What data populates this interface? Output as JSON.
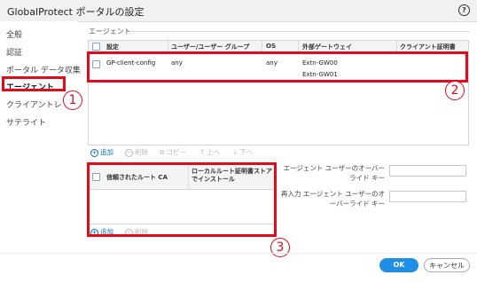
{
  "title": "GlobalProtect ポータルの設定",
  "sidebar": {
    "items": [
      {
        "label": "全般"
      },
      {
        "label": "認証"
      },
      {
        "label": "ポータル データ収集"
      },
      {
        "label": "エージェント"
      },
      {
        "label": "クライアントレ"
      },
      {
        "label": "サテライト"
      }
    ],
    "active_index": 3
  },
  "agent_section": {
    "label": "エージェント",
    "columns": [
      "設定",
      "ユーザー/ユーザー グループ",
      "OS",
      "外部ゲートウェイ",
      "クライアント証明書"
    ],
    "rows": [
      {
        "name": "GP-client-config",
        "users": "any",
        "os": "any",
        "gateways": [
          "Extn-GW00",
          "Extn-GW01"
        ],
        "cert": ""
      }
    ],
    "toolbar": [
      {
        "icon": "+",
        "label": "追加",
        "enabled": true
      },
      {
        "icon": "−",
        "label": "削除",
        "enabled": false
      },
      {
        "icon": "⧉",
        "label": "コピー",
        "enabled": false
      },
      {
        "icon": "↑",
        "label": "上へ",
        "enabled": false
      },
      {
        "icon": "↓",
        "label": "下へ",
        "enabled": false
      }
    ]
  },
  "trusted_ca": {
    "columns": [
      "信頼されたルート CA",
      "ローカルルート証明書ストアでインストール"
    ],
    "toolbar": [
      {
        "icon": "+",
        "label": "追加",
        "enabled": true
      },
      {
        "icon": "−",
        "label": "削除",
        "enabled": false
      }
    ]
  },
  "override_fields": {
    "field1_label": "エージェント ユーザーのオーバーライド キー",
    "field1_value": "",
    "field2_label": "再入力 エージェント ユーザーのオーバーライド キー",
    "field2_value": ""
  },
  "annotations": [
    {
      "number": "1"
    },
    {
      "number": "2"
    },
    {
      "number": "3"
    }
  ],
  "buttons": {
    "ok": "OK",
    "cancel": "キャンセル"
  },
  "colors": {
    "highlight": "#e00b1c",
    "primary_button": "#1f8ee6",
    "link": "#0a6ebd"
  }
}
